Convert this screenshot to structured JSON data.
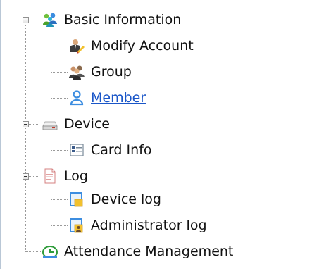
{
  "tree": {
    "basic_information": {
      "label": "Basic Information",
      "children": {
        "modify_account": "Modify Account",
        "group": "Group",
        "member": "Member"
      }
    },
    "device": {
      "label": "Device",
      "children": {
        "card_info": "Card Info"
      }
    },
    "log": {
      "label": "Log",
      "children": {
        "device_log": "Device log",
        "administrator_log": "Administrator log"
      }
    },
    "attendance_management": {
      "label": "Attendance Management"
    }
  },
  "colors": {
    "link": "#1a56c8",
    "text": "#111111",
    "tree_line": "#9a9a9a",
    "panel_border": "#b9c7d6"
  },
  "icons": {
    "basic_information": "people-group-icon",
    "modify_account": "user-edit-icon",
    "group": "user-group-icon",
    "member": "user-icon",
    "device": "device-icon",
    "card_info": "card-icon",
    "log": "document-icon",
    "device_log": "device-log-icon",
    "administrator_log": "admin-log-icon",
    "attendance_management": "attendance-clock-icon"
  }
}
